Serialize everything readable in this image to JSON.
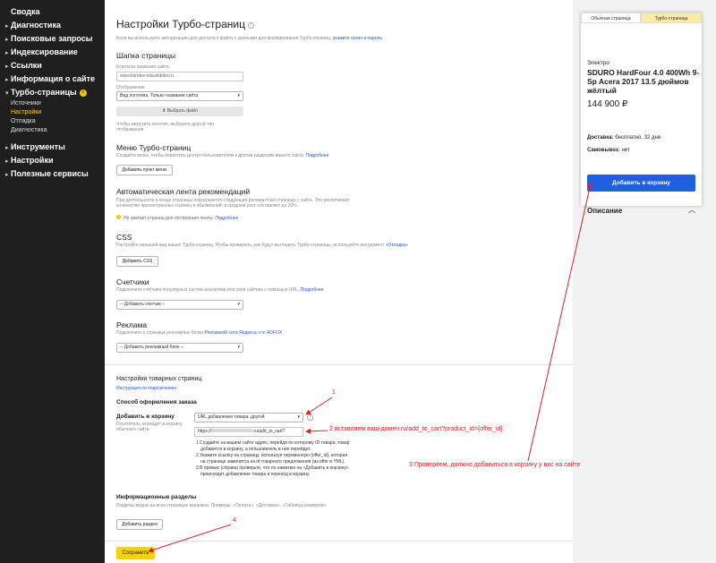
{
  "sidebar": {
    "items": [
      {
        "label": "Сводка"
      },
      {
        "label": "Диагностика"
      },
      {
        "label": "Поисковые запросы"
      },
      {
        "label": "Индексирование"
      },
      {
        "label": "Ссылки"
      },
      {
        "label": "Информация о сайте"
      },
      {
        "label": "Турбо-страницы"
      },
      {
        "label": "Инструменты"
      },
      {
        "label": "Настройки"
      },
      {
        "label": "Полезные сервисы"
      }
    ],
    "sub_items": [
      {
        "label": "Источники"
      },
      {
        "label": "Настройки"
      },
      {
        "label": "Отладка"
      },
      {
        "label": "Диагностика"
      }
    ]
  },
  "main": {
    "title": "Настройки Турбо-страниц",
    "intro": "Если вы используете авторизацию для доступа к файлу с данными для формирования Турбо-страниц,",
    "intro_link": "укажите логин и пароль",
    "header_section": {
      "title": "Шапка страницы",
      "short_name_label": "Короткое название сайта",
      "short_name_value": "www.korotov-stacdobiko.ru",
      "display_label": "Отображение",
      "display_value": "Вид логотипа. Только название сайта",
      "choose_file": "Выбрать файл",
      "hint1": "Чтобы загрузить логотип, выберите другой тип",
      "hint2": "отображения"
    },
    "menu_section": {
      "title": "Меню Турбо-страниц",
      "desc": "Создайте меню, чтобы упростить доступ пользователям к другим разделам вашего сайта.",
      "link": "Подробнее",
      "button": "Добавить пункт меню"
    },
    "feed_section": {
      "title": "Автоматическая лента рекомендаций",
      "desc1": "При деятельности в конце страницы подгружается следующая релевантная страница с сайта. Это увеличивает",
      "desc2": "количество просмотренных страниц и объявлений: в среднем рост составляет до 30%.",
      "warning": "Не хватает страниц для построения ленты.",
      "link": "Подробнее"
    },
    "css_section": {
      "title": "CSS",
      "desc": "Настройте внешний вид ваших Турбо-страниц. Чтобы проверить, как будут выглядеть Турбо-страницы, используйте инструмент",
      "link": "«Отладка»",
      "button": "Добавить CSS"
    },
    "counters_section": {
      "title": "Счетчики",
      "desc": "Подключите счетчики популярных систем аналитики или свои сайтике с помощью URL.",
      "link": "Подробнее",
      "select": "-- Добавить счетчик --"
    },
    "ads_section": {
      "title": "Реклама",
      "desc": "Подключите к странице рекламные блоки",
      "link1": "Рекламной сети Яндекса",
      "or": "или",
      "link2": "ADFOX",
      "select": "-- Добавить рекламный блок --"
    },
    "shop_section": {
      "title": "Настройки товарных страниц",
      "link": "Инструкция по подключению",
      "order_title": "Способ оформления заказа",
      "cart_label": "Добавить в корзину",
      "cart_desc1": "Посетитель перейдет в корзину",
      "cart_desc2": "обычного сайта",
      "cart_select": "URL добавления товара: другой",
      "cart_input_prefix": "https://",
      "cart_input_suffix": ".ru/add_to_cart?",
      "steps": [
        "1  Создайте на вашем сайте адрес, перейдя по которому ID товара, товар",
        "добавится в корзину, а пользователь в нее перейдет.",
        "2  Укажите ссылку на страницу, используя переменную {offer_id}, которая",
        "на странице заменится на id товарного предложения (из offer в YML).",
        "3  В превью (справа) проверьте, что по нажатию на «Добавить в корзину»",
        "происходит добавление товара и переход в корзину."
      ],
      "info_title": "Информационные разделы",
      "info_desc": "Разделы видны на всех страницах магазина. Примеры: «Оплата», «Доставка», «Таблица размеров»",
      "info_button": "Добавить раздел"
    },
    "save_button": "Сохранить"
  },
  "preview": {
    "tab_regular": "Обычная страница",
    "tab_turbo": "Турбо-страница",
    "category": "Электро",
    "title": "SDURO HardFour 4.0 400Wh 9-Sp Acera 2017 13.5 дюймов жёлтый",
    "price": "144 900 ₽",
    "delivery_label": "Доставка:",
    "delivery_value": "бесплатно, 32 дня",
    "pickup_label": "Самовывоз:",
    "pickup_value": "нет",
    "buy_button": "Добавить в корзину",
    "description": "Описание"
  },
  "annotations": {
    "n1": "1",
    "n2": "2 вставляем  ваш-домен.ru/add_to_cart?product_id={offer_id}",
    "n3": "3 Проверяем, должно добавиться в корзину у вас на сайте",
    "n4": "4"
  },
  "colors": {
    "sidebar_bg": "#1f1f1f",
    "accent_yellow": "#f5d20b",
    "link_blue": "#2a59c6",
    "annotation_red": "#e02020",
    "buy_blue": "#1f5fe0"
  }
}
